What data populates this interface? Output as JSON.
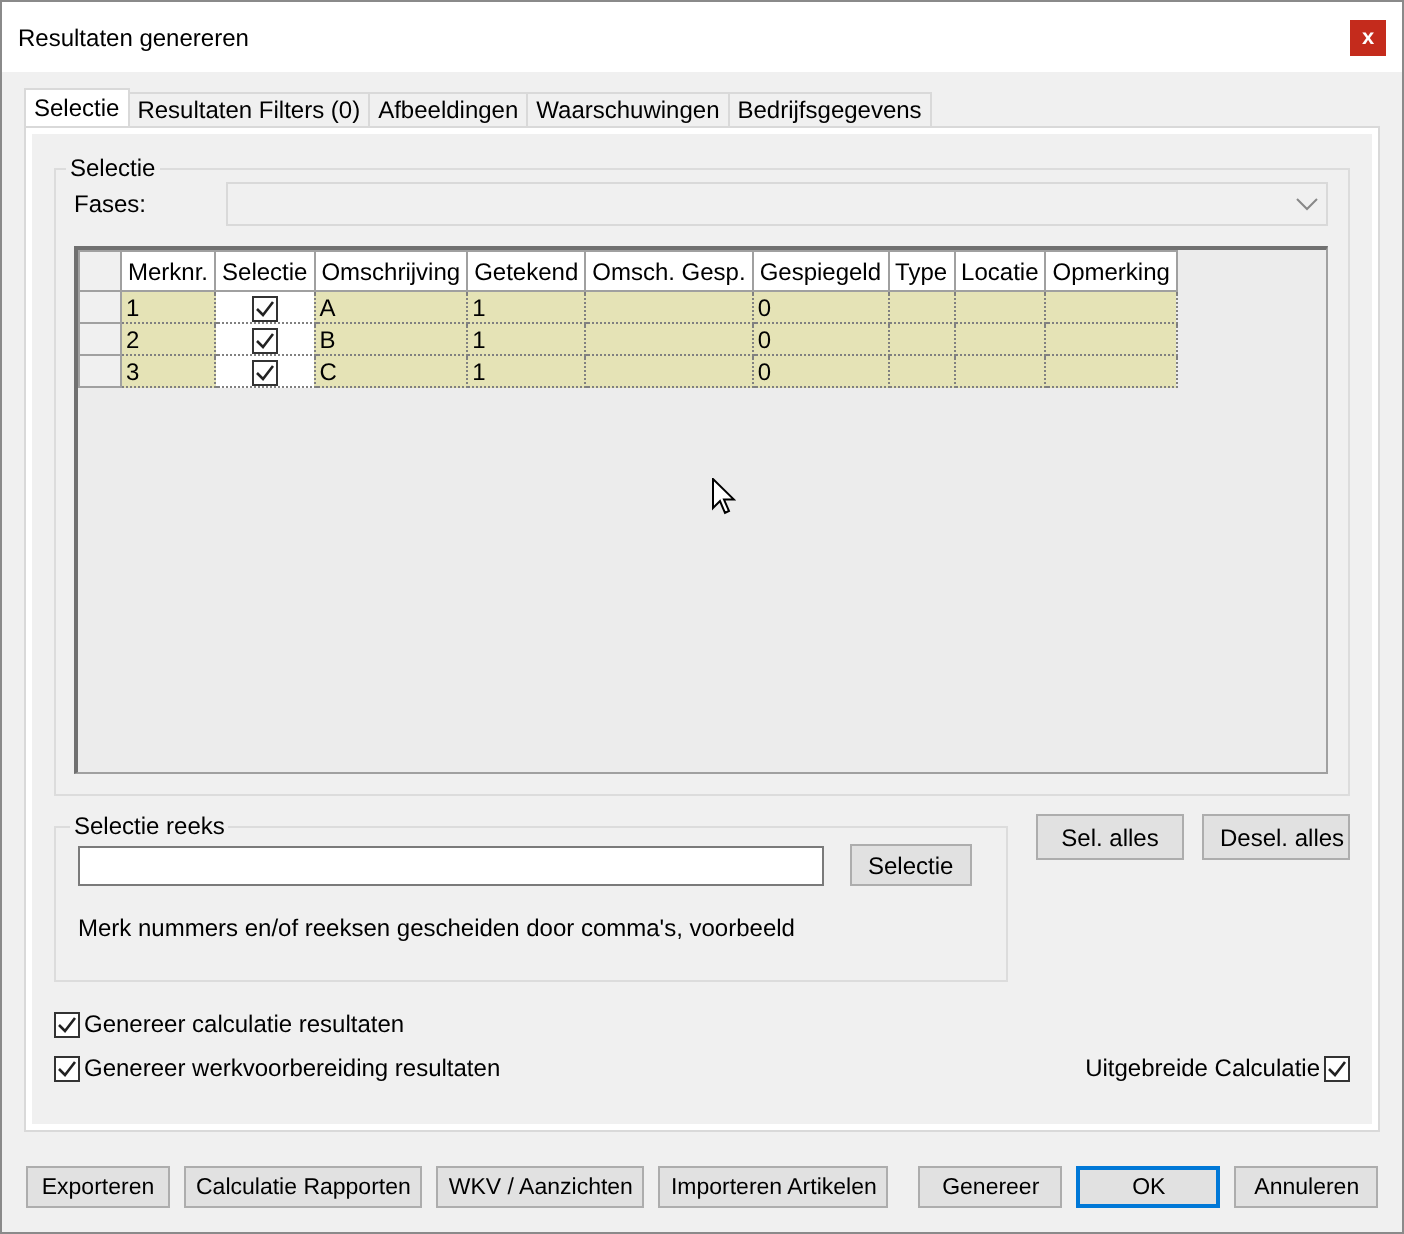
{
  "window": {
    "title": "Resultaten genereren",
    "close": "x"
  },
  "tabs": [
    {
      "label": "Selectie",
      "selected": true
    },
    {
      "label": "Resultaten Filters (0)",
      "selected": false
    },
    {
      "label": "Afbeeldingen",
      "selected": false
    },
    {
      "label": "Waarschuwingen",
      "selected": false
    },
    {
      "label": "Bedrijfsgegevens",
      "selected": false
    }
  ],
  "selection_group": {
    "title": "Selectie",
    "fases_label": "Fases:"
  },
  "grid": {
    "columns": [
      "Merknr.",
      "Selectie",
      "Omschrijving",
      "Getekend",
      "Omsch. Gesp.",
      "Gespiegeld",
      "Type",
      "Locatie",
      "Opmerking"
    ],
    "rows": [
      {
        "merknr": "1",
        "checked": true,
        "omschrijving": "A",
        "getekend": "1",
        "gespiegeld": "0"
      },
      {
        "merknr": "2",
        "checked": true,
        "omschrijving": "B",
        "getekend": "1",
        "gespiegeld": "0"
      },
      {
        "merknr": "3",
        "checked": true,
        "omschrijving": "C",
        "getekend": "1",
        "gespiegeld": "0"
      }
    ]
  },
  "range_group": {
    "title": "Selectie reeks",
    "button": "Selectie",
    "hint": "Merk nummers en/of reeksen gescheiden door comma's, voorbeeld"
  },
  "side_buttons": [
    "Sel. alles",
    "Desel. alles"
  ],
  "options": [
    {
      "label": "Genereer calculatie resultaten",
      "checked": true
    },
    {
      "label": "Genereer werkvoorbereiding resultaten",
      "checked": true
    }
  ],
  "extended": {
    "label": "Uitgebreide Calculatie",
    "checked": true
  },
  "footer_buttons": [
    {
      "label": "Exporteren",
      "default": false
    },
    {
      "label": "Calculatie Rapporten",
      "default": false
    },
    {
      "label": "WKV / Aanzichten",
      "default": false
    },
    {
      "label": "Importeren Artikelen",
      "default": false
    },
    {
      "label": "Genereer",
      "default": false
    },
    {
      "label": "OK",
      "default": true
    },
    {
      "label": "Annuleren",
      "default": false
    }
  ]
}
